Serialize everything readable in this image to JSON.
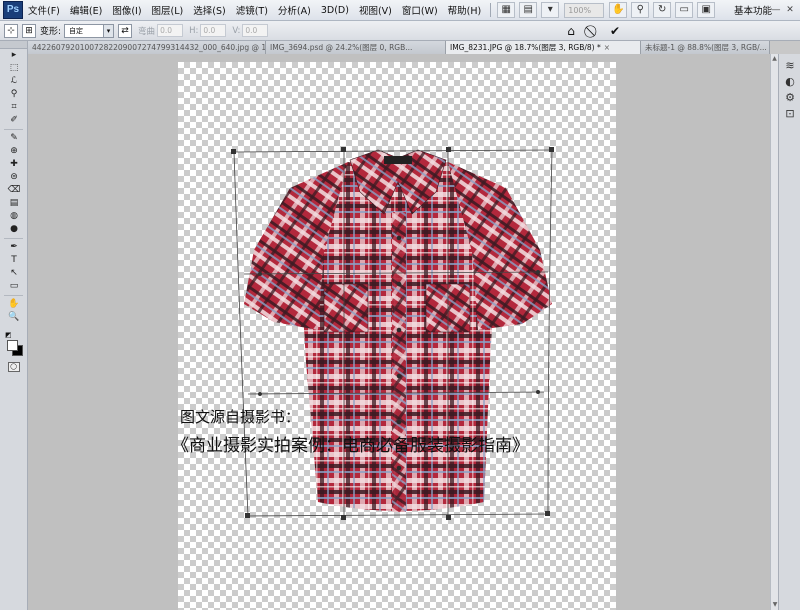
{
  "app": {
    "logo": "Ps"
  },
  "menu": [
    "文件(F)",
    "编辑(E)",
    "图像(I)",
    "图层(L)",
    "选择(S)",
    "滤镜(T)",
    "分析(A)",
    "3D(D)",
    "视图(V)",
    "窗口(W)",
    "帮助(H)"
  ],
  "menubar": {
    "zoom": "100%",
    "workspace": "基本功能",
    "minimize": "—",
    "restore": "❐",
    "close": "✕"
  },
  "options": {
    "transform_label": "变形:",
    "warp_value": "自定",
    "h_label": "弯曲",
    "h_value": "0.0",
    "hx_label": "H:",
    "hx_value": "0.0",
    "v_label": "V:",
    "v_value": "0.0"
  },
  "tabs": [
    {
      "label": "442260792010072822090072747993144​32_000_640.jpg @ 100%...",
      "active": false
    },
    {
      "label": "IMG_3694.psd @ 24.2%(图层 0, RGB...",
      "active": false
    },
    {
      "label": "IMG_8231.JPG @ 18.7%(图层 3, RGB/8) *",
      "active": true
    },
    {
      "label": "未标题-1 @ 88.8%(图层 3, RGB/...",
      "active": false
    }
  ],
  "tools": [
    "▸",
    "⬚",
    "ℒ",
    "⚲",
    "⌗",
    "✐",
    "✎",
    "⊕",
    "✚",
    "⊜",
    "⌫",
    "▤",
    "◍",
    "●",
    "✒",
    "T",
    "↖",
    "▭",
    "✋",
    "🔍"
  ],
  "right_icons": [
    "≋",
    "◐",
    "⚙",
    "⊡"
  ],
  "canvas": {
    "caption_line1": "图文源自摄影书：",
    "caption_line2": "《商业摄影实拍案例：电商必备服装摄影指南》"
  },
  "colors": {
    "shirt_red": "#b3283c",
    "shirt_dark": "#3a1a22",
    "shirt_light": "#f3dfe2",
    "shirt_blue": "#8aa2c8",
    "accent_active_tab": "#e9ebee"
  }
}
